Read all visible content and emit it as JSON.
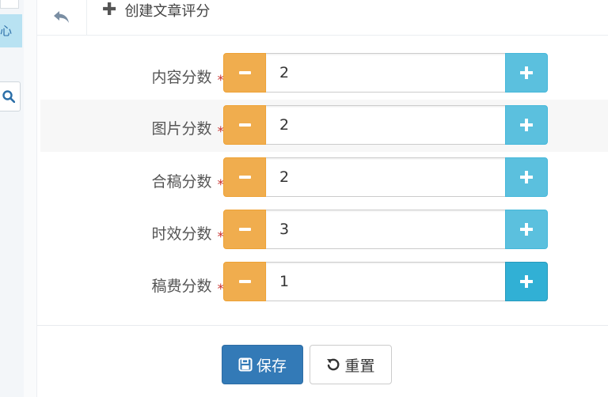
{
  "sidebar": {
    "active_glyph": "心",
    "search_icon": "search-icon"
  },
  "header": {
    "back_icon": "reply-icon",
    "add_icon": "plus-icon",
    "title": "创建文章评分"
  },
  "fields": [
    {
      "label": "内容分数",
      "value": "2",
      "required": "*"
    },
    {
      "label": "图片分数",
      "value": "2",
      "required": "*"
    },
    {
      "label": "合稿分数",
      "value": "2",
      "required": "*"
    },
    {
      "label": "时效分数",
      "value": "3",
      "required": "*"
    },
    {
      "label": "稿费分数",
      "value": "1",
      "required": "*"
    }
  ],
  "buttons": {
    "save": "保存",
    "reset": "重置"
  },
  "colors": {
    "minus": "#f0ad4e",
    "plus": "#5bc0de",
    "plus_hover": "#31b0d5",
    "primary": "#337ab7",
    "required": "#c9302c"
  }
}
